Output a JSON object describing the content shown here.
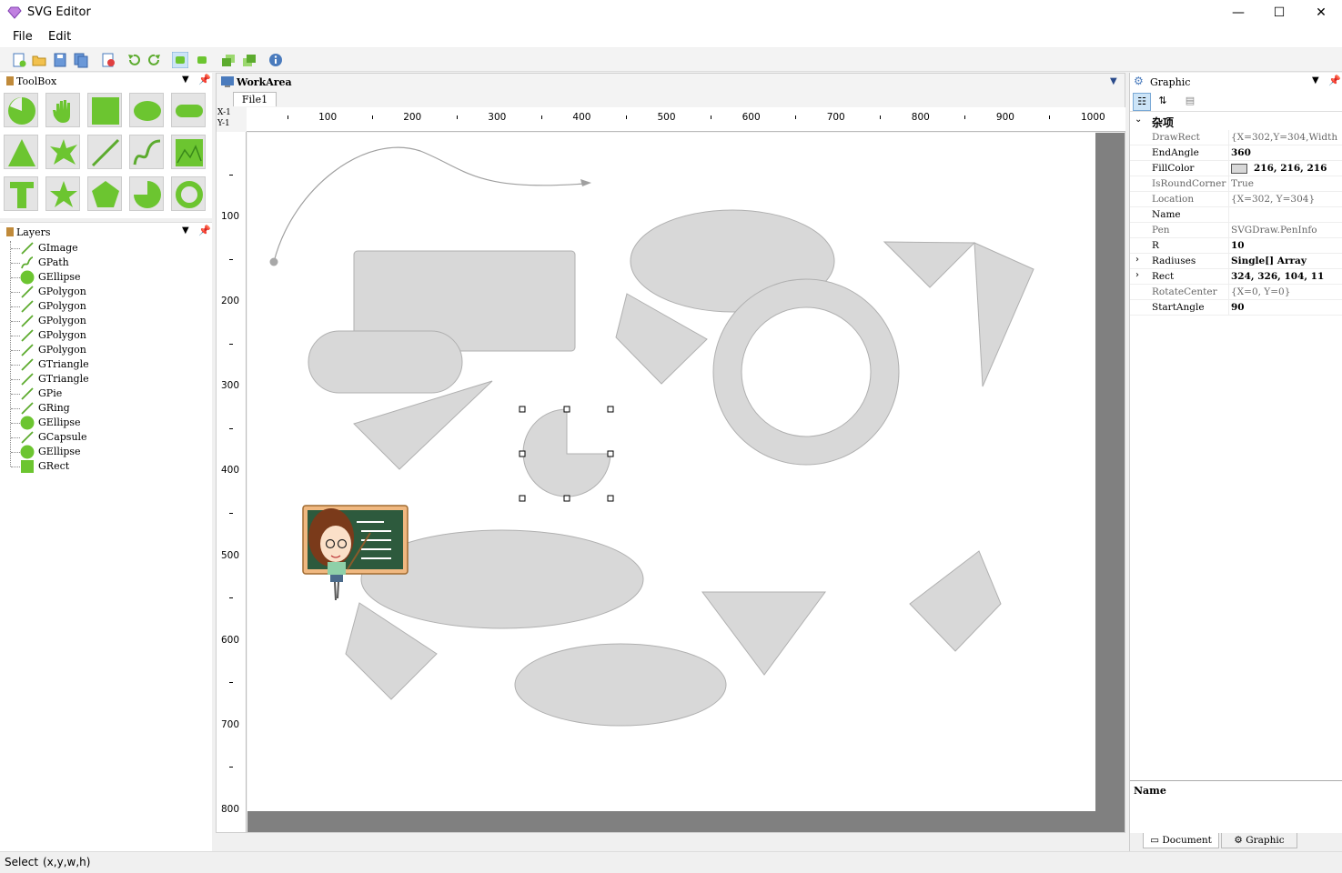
{
  "window": {
    "title": "SVG Editor"
  },
  "menu": {
    "file": "File",
    "edit": "Edit"
  },
  "toolbox": {
    "title": "ToolBox"
  },
  "layers": {
    "title": "Layers",
    "items": [
      {
        "name": "GImage",
        "icon": "line-icon"
      },
      {
        "name": "GPath",
        "icon": "curve-icon"
      },
      {
        "name": "GEllipse",
        "icon": "ellipse-icon"
      },
      {
        "name": "GPolygon",
        "icon": "line-icon"
      },
      {
        "name": "GPolygon",
        "icon": "line-icon"
      },
      {
        "name": "GPolygon",
        "icon": "line-icon"
      },
      {
        "name": "GPolygon",
        "icon": "line-icon"
      },
      {
        "name": "GPolygon",
        "icon": "line-icon"
      },
      {
        "name": "GTriangle",
        "icon": "line-icon"
      },
      {
        "name": "GTriangle",
        "icon": "line-icon"
      },
      {
        "name": "GPie",
        "icon": "line-icon"
      },
      {
        "name": "GRing",
        "icon": "line-icon"
      },
      {
        "name": "GEllipse",
        "icon": "ellipse-icon"
      },
      {
        "name": "GCapsule",
        "icon": "line-icon"
      },
      {
        "name": "GEllipse",
        "icon": "ellipse-icon"
      },
      {
        "name": "GRect",
        "icon": "rect-icon"
      }
    ]
  },
  "workarea": {
    "title": "WorkArea",
    "tab": "File1",
    "corner_x": "X-1",
    "corner_y": "Y-1",
    "ruler_x": [
      "100",
      "200",
      "300",
      "400",
      "500",
      "600",
      "700",
      "800",
      "900",
      "1000"
    ],
    "ruler_y": [
      "100",
      "200",
      "300",
      "400",
      "500",
      "600",
      "700",
      "800"
    ]
  },
  "graphic_panel": {
    "title": "Graphic",
    "category": "杂项",
    "properties": [
      {
        "name": "DrawRect",
        "value": "{X=302,Y=304,Width",
        "style": "dim"
      },
      {
        "name": "EndAngle",
        "value": "360",
        "style": "bold"
      },
      {
        "name": "FillColor",
        "value": "216, 216, 216",
        "style": "bold",
        "swatch": "#d8d8d8"
      },
      {
        "name": "IsRoundCorner",
        "value": "True",
        "style": "dim"
      },
      {
        "name": "Location",
        "value": "{X=302, Y=304}",
        "style": "dim"
      },
      {
        "name": "Name",
        "value": "",
        "style": "normal"
      },
      {
        "name": "Pen",
        "value": "SVGDraw.PenInfo",
        "style": "dim"
      },
      {
        "name": "R",
        "value": "10",
        "style": "bold"
      },
      {
        "name": "Radiuses",
        "value": "Single[] Array",
        "style": "bold",
        "expandable": true
      },
      {
        "name": "Rect",
        "value": "324, 326, 104, 11",
        "style": "bold",
        "expandable": true
      },
      {
        "name": "RotateCenter",
        "value": "{X=0, Y=0}",
        "style": "dim"
      },
      {
        "name": "StartAngle",
        "value": "90",
        "style": "bold"
      }
    ],
    "description_title": "Name",
    "bottom_tabs": [
      "Document",
      "Graphic"
    ]
  },
  "status": {
    "mode": "Select",
    "coords": "(x,y,w,h)"
  },
  "colors": {
    "accent_green": "#6cc530",
    "shape_fill": "#d8d8d8",
    "shape_stroke": "#b0b0b0"
  }
}
